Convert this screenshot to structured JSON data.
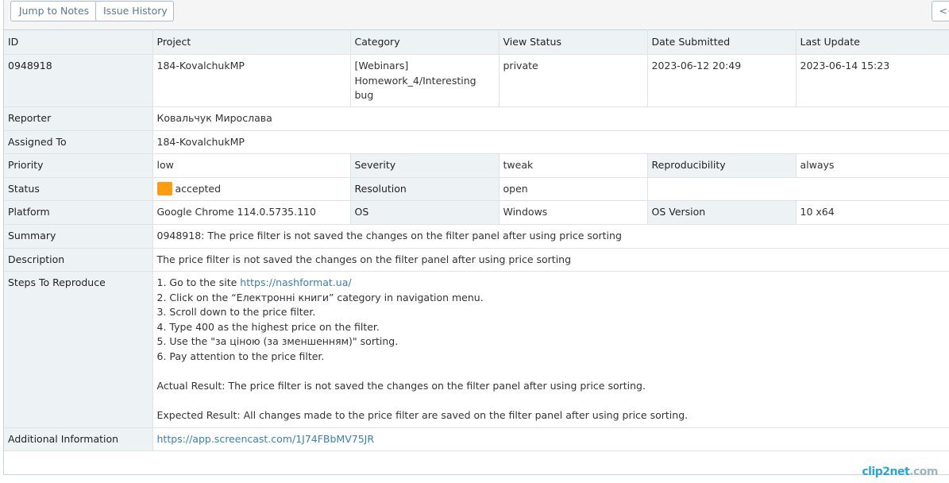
{
  "toolbar": {
    "jump_to_notes": "Jump to Notes",
    "issue_history": "Issue History",
    "prev": "<<"
  },
  "header": {
    "id": "ID",
    "project": "Project",
    "category": "Category",
    "view_status": "View Status",
    "date_submitted": "Date Submitted",
    "last_update": "Last Update"
  },
  "issue": {
    "id": "0948918",
    "project": "184-KovalchukMP",
    "category": "[Webinars] Homework_4/Interesting bug",
    "view_status": "private",
    "date_submitted": "2023-06-12 20:49",
    "last_update": "2023-06-14 15:23"
  },
  "labels": {
    "reporter": "Reporter",
    "assigned_to": "Assigned To",
    "priority": "Priority",
    "severity": "Severity",
    "reproducibility": "Reproducibility",
    "status": "Status",
    "resolution": "Resolution",
    "platform": "Platform",
    "os": "OS",
    "os_version": "OS Version",
    "summary": "Summary",
    "description": "Description",
    "steps": "Steps To Reproduce",
    "additional": "Additional Information"
  },
  "values": {
    "reporter": "Ковальчук Мирослава",
    "assigned_to": "184-KovalchukMP",
    "priority": "low",
    "severity": "tweak",
    "reproducibility": "always",
    "status": "accepted",
    "status_color": "#ff9c10",
    "resolution": "open",
    "platform": "Google Chrome 114.0.5735.110",
    "os": "Windows",
    "os_version": "10 x64",
    "summary": "0948918: The price filter is not saved the changes on the filter panel after using price sorting",
    "description": "The price filter is not saved the changes on the filter panel after using price sorting",
    "additional_link": "https://app.screencast.com/1J74FBbMV75JR"
  },
  "steps": {
    "step1_prefix": "1. Go to the site ",
    "step1_link": "https://nashformat.ua/",
    "step2": "2. Click on the “Електронні книги” category in navigation menu.",
    "step3": "3. Scroll down to the price filter.",
    "step4": "4. Type 400 as the highest price on the filter.",
    "step5": "5. Use the \"за ціною (за зменшенням)\" sorting.",
    "step6": "6. Pay attention to the price filter.",
    "actual": "Actual Result: The price filter is not saved the changes on the filter panel after using price sorting.",
    "expected": "Expected Result: All changes made to the price filter are saved on the filter panel after using price sorting."
  },
  "watermark": {
    "part1": "clip2net",
    "part2": ".com"
  }
}
